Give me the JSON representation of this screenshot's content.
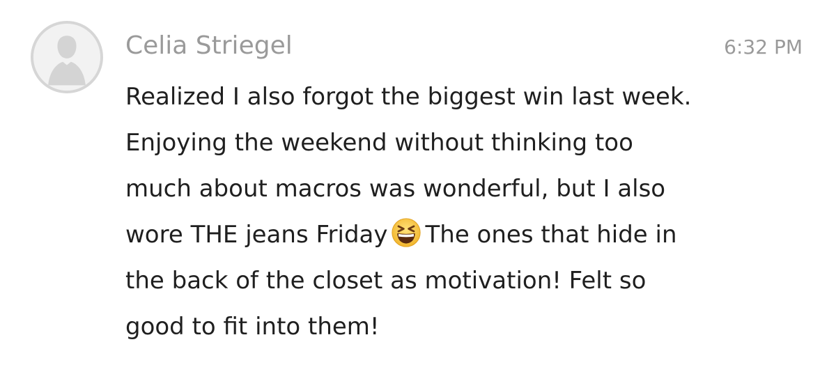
{
  "message": {
    "sender": "Celia Striegel",
    "time": "6:32 PM",
    "lines": [
      "Realized I also forgot the biggest win last week.",
      "Enjoying the weekend without thinking too",
      "much about macros was wonderful, but I also"
    ],
    "line4_before_emoji": "wore THE jeans Friday",
    "line4_after_emoji": "The ones that hide in",
    "lines_after": [
      "the back of the closet as motivation! Felt so",
      "good to fit into them!"
    ],
    "emoji_icon": "laughing-squinting-face-icon",
    "avatar_icon": "default-user-silhouette-icon"
  },
  "colors": {
    "name": "#9a9a9a",
    "time": "#9a9a9a",
    "text": "#1f1f1f",
    "avatar_bg": "#f2f2f2",
    "avatar_border": "#d6d6d6",
    "silhouette": "#d4d4d4",
    "emoji_face": "#f5c542"
  }
}
